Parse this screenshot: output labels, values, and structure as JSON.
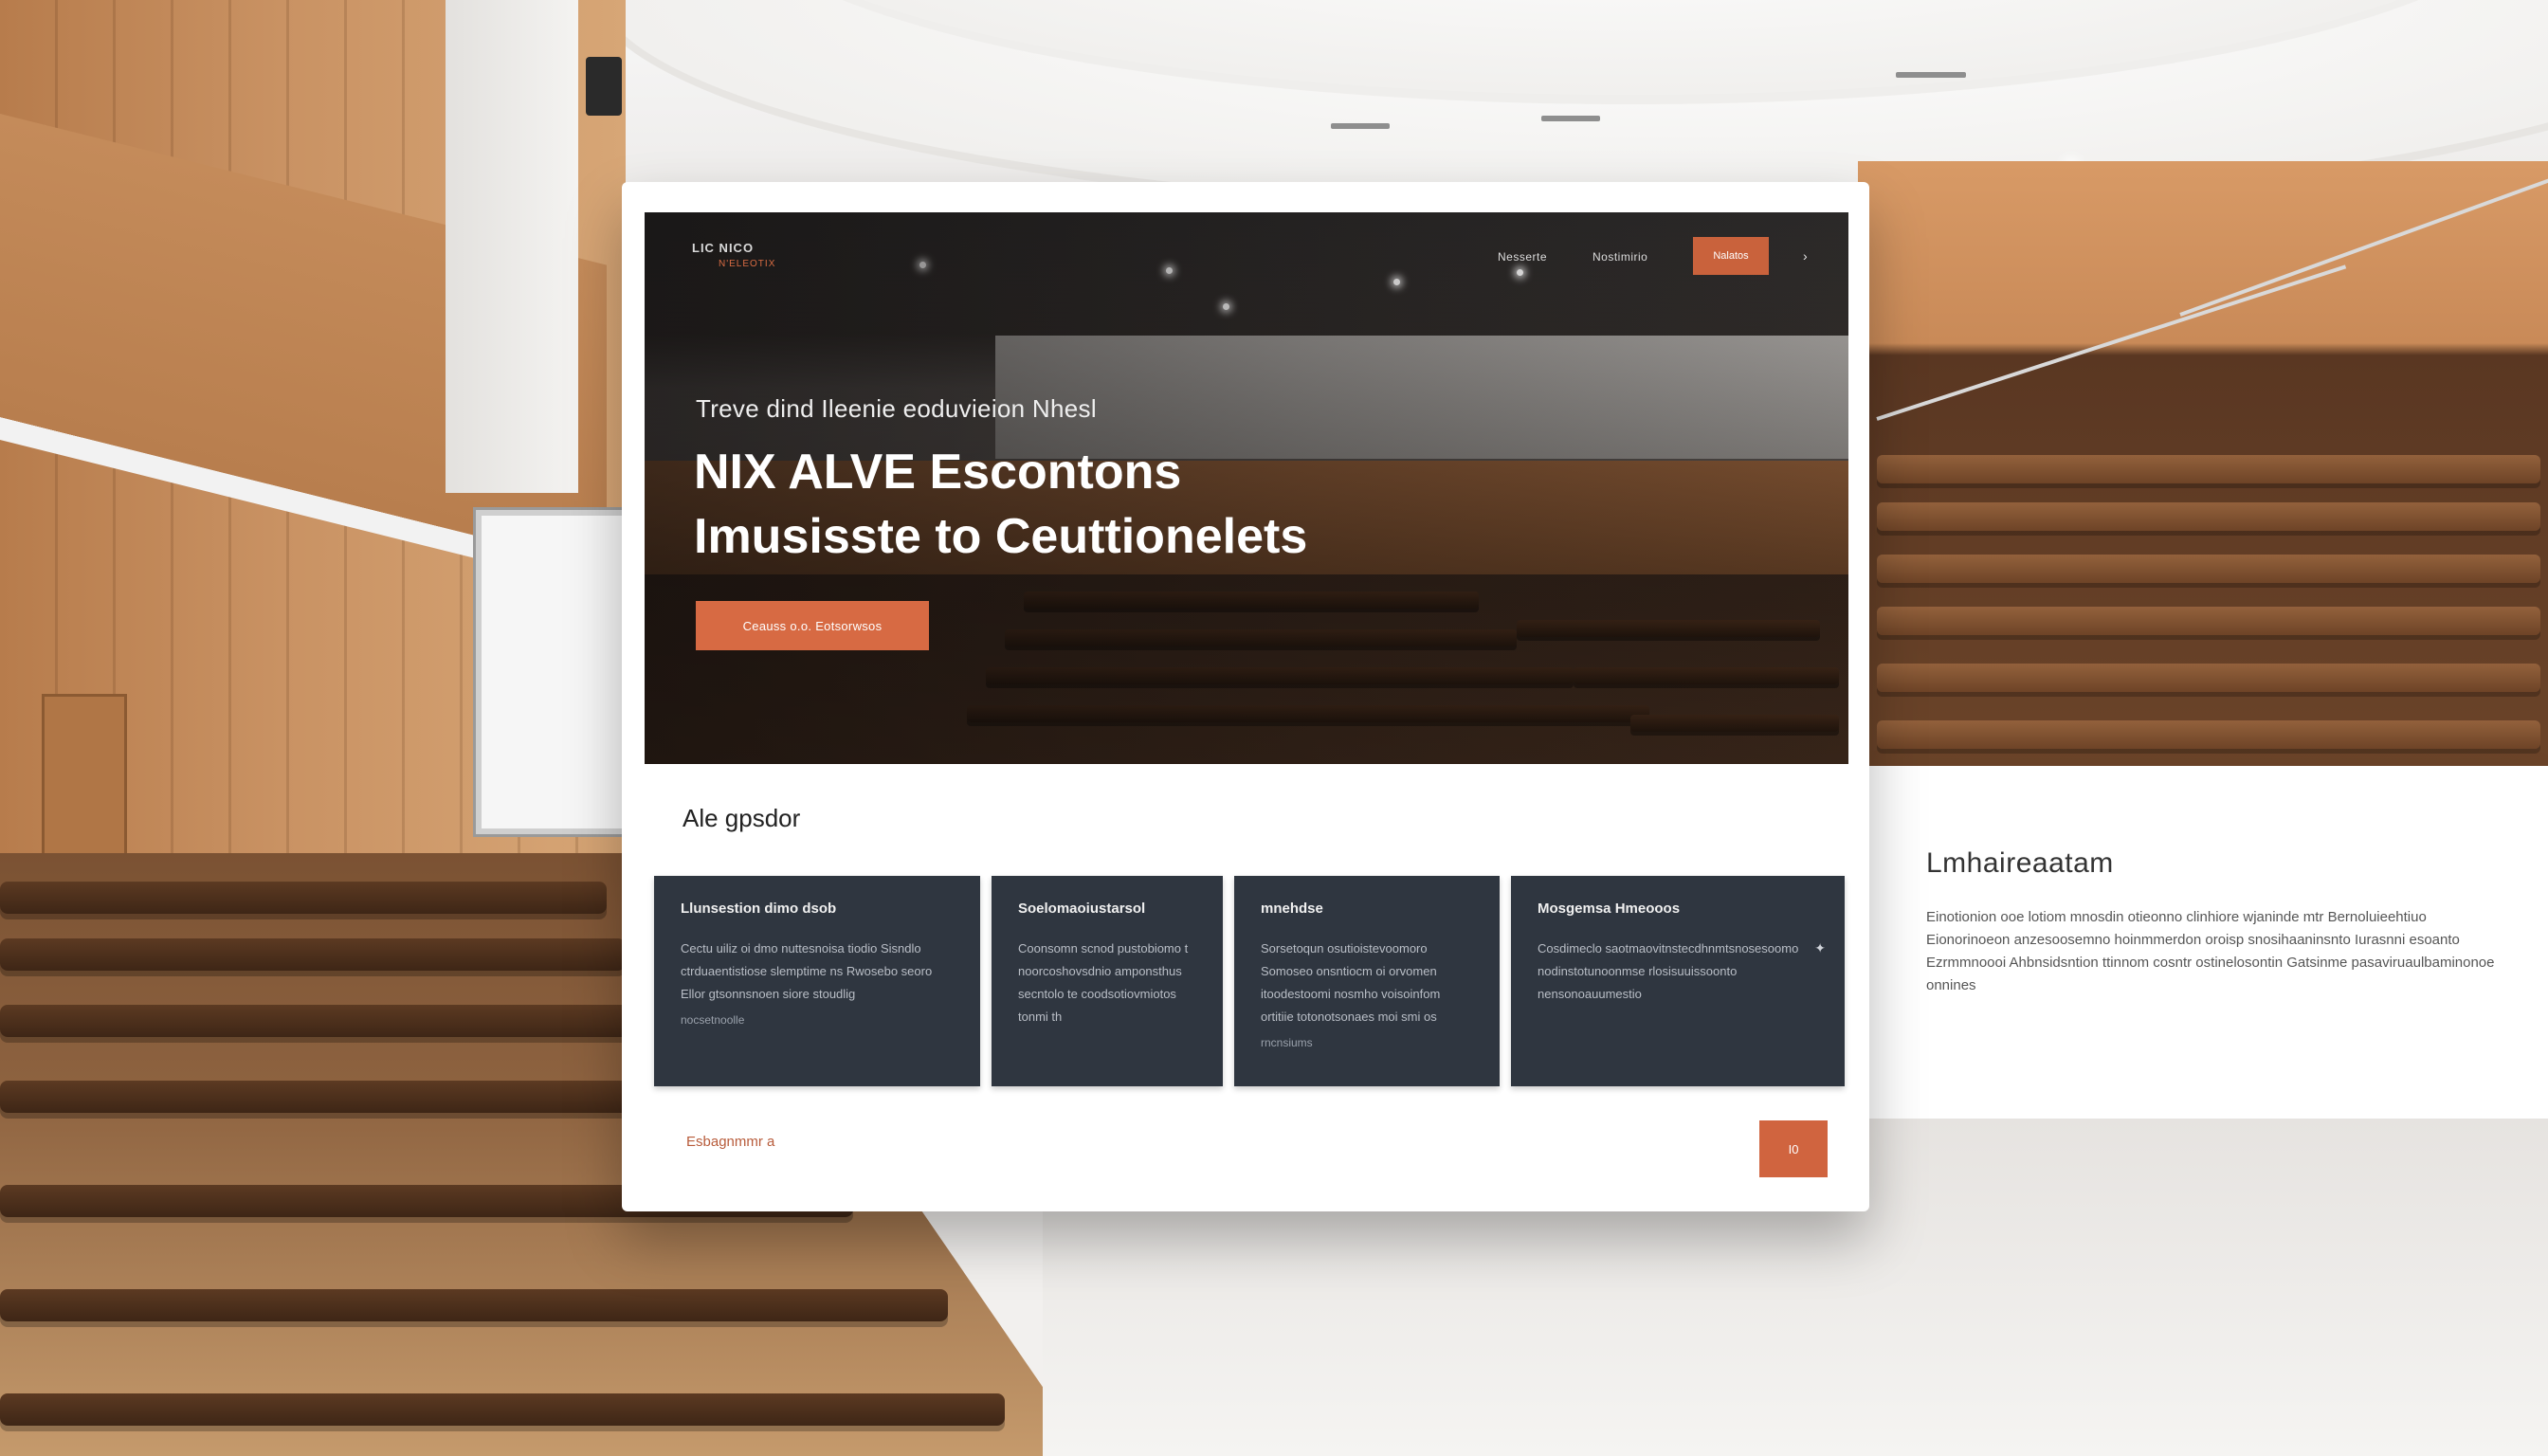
{
  "nav": {
    "logo_text": "LIC NICO",
    "logo_sub": "N'ELEOTIX",
    "links": [
      "Nesserte",
      "Nostimirio"
    ],
    "cta_label": "Nalatos",
    "extra_icon": "chevron-icon",
    "extra_glyph": "›"
  },
  "hero": {
    "kicker": "Treve dind Ileenie eoduvieion Nhesl",
    "title_line1": "NIX ALVE Escontons",
    "title_line2": "Imusisste to Ceuttionelets",
    "cta_label": "Ceauss o.o. Eotsorwsos"
  },
  "section": {
    "title": "Ale gpsdor"
  },
  "tiles": [
    {
      "title": "Llunsestion dimo dsob",
      "text": "Cectu uiliz oi dmo nuttesnoisa tiodio Sisndlo ctrduaentistiose slemptime ns Rwosebo seoro Ellor gtsonnsnoen siore stoudlig",
      "more": "nocsetnoolle"
    },
    {
      "title": "Soelomaoiustarsol",
      "text": "Coonsomn scnod pustobiomo t noorcoshovsdnio amponsthus secntolo te coodsotiovmiotos tonmi th",
      "more": ""
    },
    {
      "title": "mnehdse",
      "text": "Sorsetoqun osutioistevoomoro Somoseo onsntiocm oi orvomen itoodestoomi nosmho voisoinfom ortitiie totonotsonaes moi smi os",
      "more": "rncnsiums"
    },
    {
      "title": "Mosgemsa Hmeooos",
      "text": "Cosdimeclo saotmaovitnstecdhnmtsnosesoomo nodinstotunoonmse rlosisuuissoonto nensonoauumestio",
      "more": ""
    }
  ],
  "footer": {
    "link_text": "Esbagnmmr a",
    "button_label": "I0"
  },
  "side_panel": {
    "title": "Lmhaireaatam",
    "text": "Einotionion ooe lotiom mnosdin otieonno clinhiore wjaninde mtr Bernoluieehtiuo Eionorinoeon anzesoosemno hoinmmerdon oroisp snosihaaninsnto Iurasnni esoanto Ezrmmnoooi Ahbnsidsntion ttinnom cosntr ostinelosontin Gatsinme pasaviruaulbaminonoe onnines"
  },
  "colors": {
    "accent": "#d76a43",
    "tile_bg": "#2f3640",
    "card_bg": "#ffffff"
  }
}
